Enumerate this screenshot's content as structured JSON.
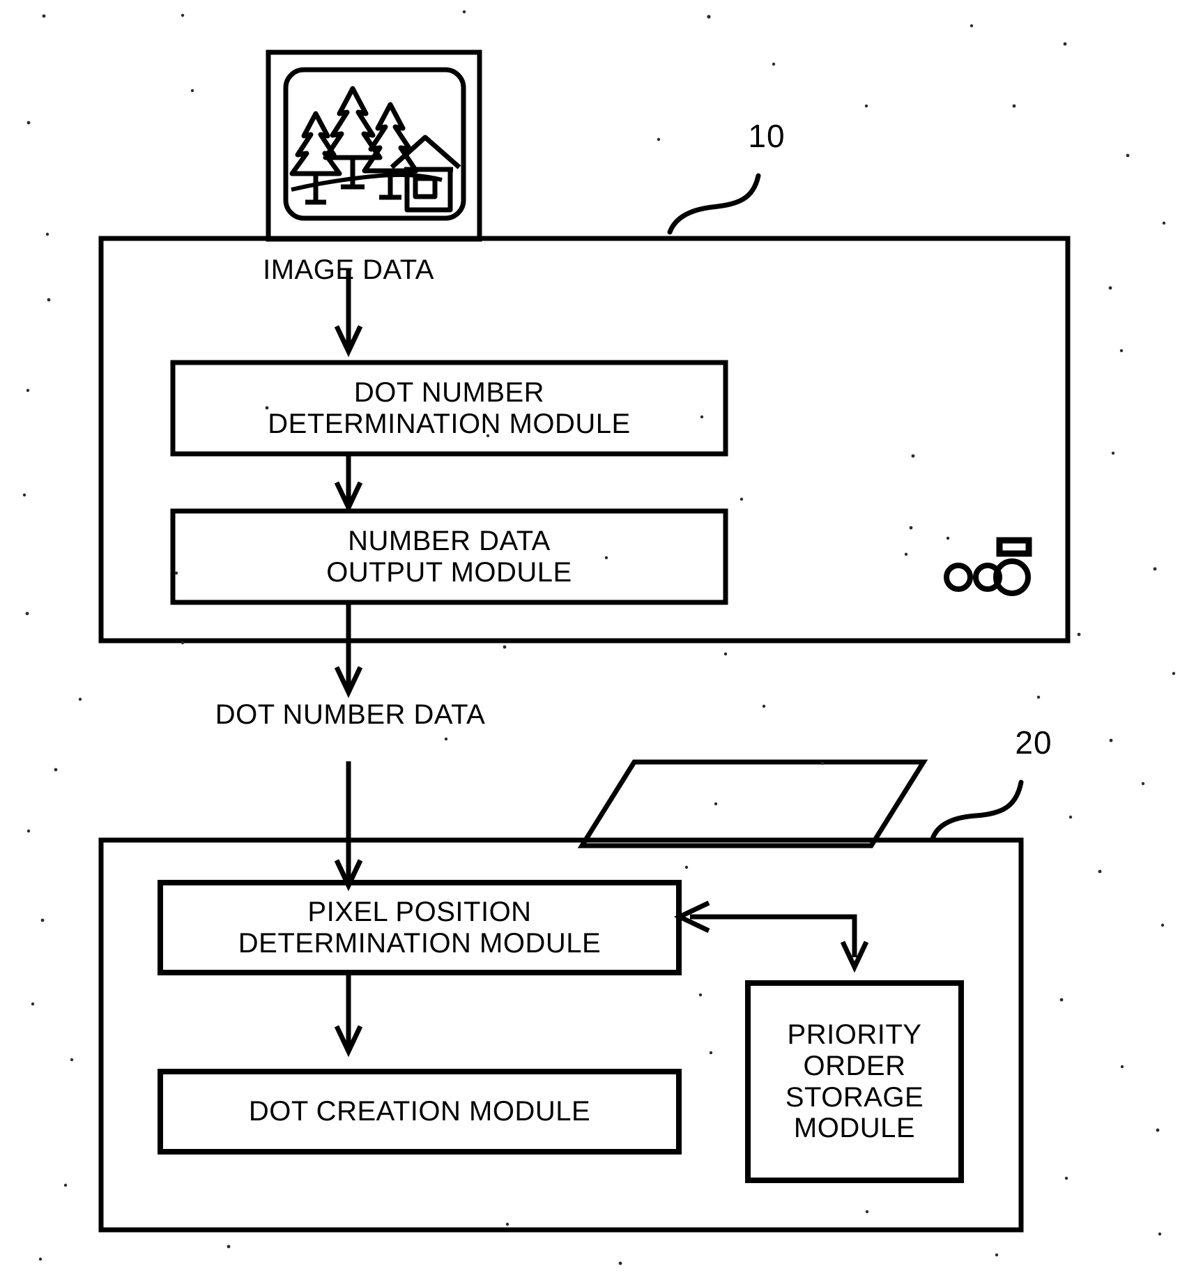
{
  "figure": {
    "type": "patent-block-diagram",
    "background_color": "#ffffff",
    "ink_color": "#000000"
  },
  "reference_numerals": {
    "upper_device": "10",
    "lower_device": "20"
  },
  "source_icon": {
    "name": "scanned-photo-icon",
    "scene": "trees-and-house"
  },
  "device_controls": {
    "small_button_1": "button-small-left",
    "small_button_2": "button-small-right",
    "large_button": "button-large-power",
    "indicator": "indicator-slot"
  },
  "flow_labels": {
    "image_data": "IMAGE DATA",
    "dot_number_data": "DOT NUMBER DATA"
  },
  "upper_device_modules": [
    {
      "id": "dot-number-determination-module",
      "line1": "DOT NUMBER",
      "line2": "DETERMINATION MODULE"
    },
    {
      "id": "number-data-output-module",
      "line1": "NUMBER DATA",
      "line2": "OUTPUT MODULE"
    }
  ],
  "lower_device_modules": [
    {
      "id": "pixel-position-determination-module",
      "line1": "PIXEL POSITION",
      "line2": "DETERMINATION MODULE"
    },
    {
      "id": "dot-creation-module",
      "line1": "DOT CREATION MODULE",
      "line2": ""
    },
    {
      "id": "priority-order-storage-module",
      "line1": "PRIORITY",
      "line2": "ORDER",
      "line3": "STORAGE",
      "line4": "MODULE"
    }
  ],
  "connectors": [
    {
      "id": "image-data-to-dot-number",
      "from": "image-data-label",
      "to": "dot-number-determination-module",
      "style": "arrow-down"
    },
    {
      "id": "dot-number-to-number-data-output",
      "from": "dot-number-determination-module",
      "to": "number-data-output-module",
      "style": "arrow-down"
    },
    {
      "id": "number-data-output-to-lower-device",
      "from": "number-data-output-module",
      "to": "dot-number-data-label",
      "style": "arrow-down"
    },
    {
      "id": "dot-number-data-to-pixel-position",
      "from": "dot-number-data-label",
      "to": "pixel-position-determination-module",
      "style": "arrow-down"
    },
    {
      "id": "pixel-position-to-dot-creation",
      "from": "pixel-position-determination-module",
      "to": "dot-creation-module",
      "style": "arrow-down"
    },
    {
      "id": "priority-order-feedback",
      "from": "priority-order-storage-module",
      "to": "pixel-position-determination-module",
      "style": "arrow-left-elbow"
    },
    {
      "id": "pixel-position-to-priority-order",
      "from": "feedback-bus",
      "to": "priority-order-storage-module",
      "style": "arrow-down"
    }
  ]
}
